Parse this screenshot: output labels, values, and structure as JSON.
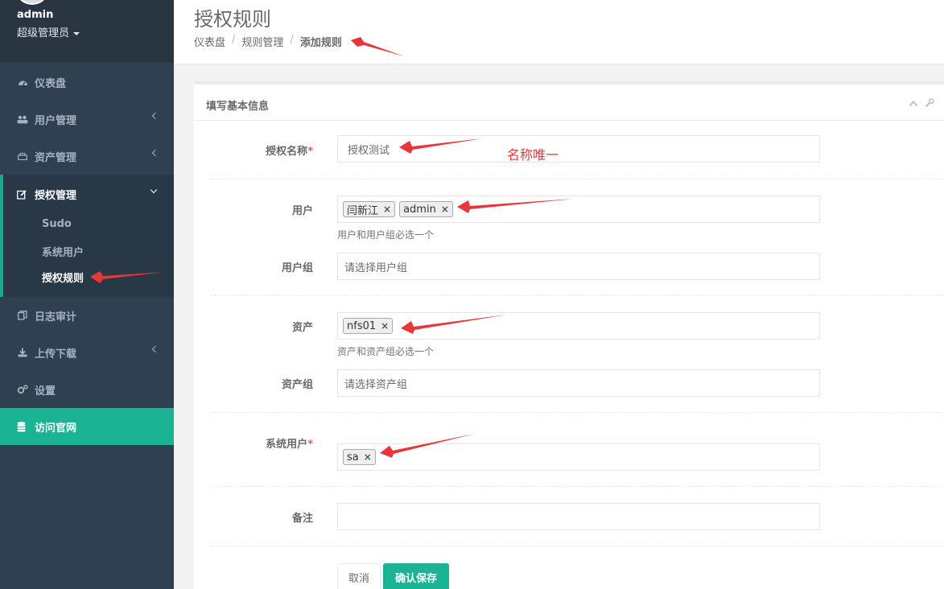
{
  "sidebar": {
    "profile": {
      "name": "admin",
      "role": "超级管理员"
    },
    "items": [
      {
        "label": "仪表盘",
        "icon": "dashboard-icon"
      },
      {
        "label": "用户管理",
        "icon": "users-icon"
      },
      {
        "label": "资产管理",
        "icon": "hdd-icon"
      },
      {
        "label": "授权管理",
        "icon": "edit-icon"
      },
      {
        "label": "日志审计",
        "icon": "copy-icon"
      },
      {
        "label": "上传下载",
        "icon": "download-icon"
      },
      {
        "label": "设置",
        "icon": "cogs-icon"
      },
      {
        "label": "访问官网",
        "icon": "database-icon"
      }
    ],
    "sub_items": [
      "Sudo",
      "系统用户",
      "授权规则"
    ]
  },
  "header": {
    "title": "授权规则",
    "breadcrumb": [
      "仪表盘",
      "规则管理",
      "添加规则"
    ]
  },
  "panel": {
    "title": "填写基本信息",
    "fields": {
      "name": {
        "label": "授权名称",
        "required": "*",
        "value": "授权测试"
      },
      "users": {
        "label": "用户",
        "tags": [
          "闫新江",
          "admin"
        ],
        "help": "用户和用户组必选一个"
      },
      "user_groups": {
        "label": "用户组",
        "placeholder": "请选择用户组"
      },
      "assets": {
        "label": "资产",
        "tags": [
          "nfs01"
        ],
        "help": "资产和资产组必选一个"
      },
      "asset_groups": {
        "label": "资产组",
        "placeholder": "请选择资产组"
      },
      "system_users": {
        "label": "系统用户",
        "required": "*",
        "tags": [
          "sa"
        ]
      },
      "comment": {
        "label": "备注",
        "value": ""
      }
    },
    "buttons": {
      "cancel": "取消",
      "save": "确认保存"
    }
  },
  "annotation": {
    "text": "名称唯一",
    "color": "#e8363b"
  },
  "colors": {
    "sidebar_bg": "#2f4050",
    "accent": "#1ab394",
    "annotation": "#e8363b"
  }
}
